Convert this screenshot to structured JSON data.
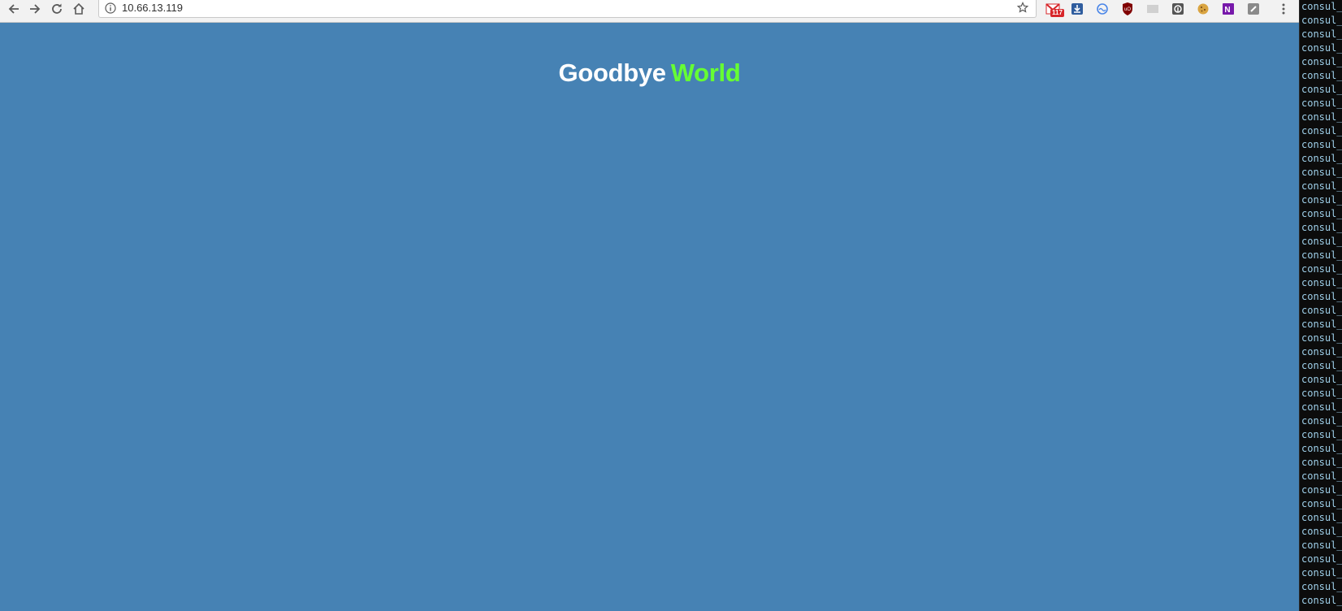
{
  "browser": {
    "url": "10.66.13.119",
    "nav": {
      "back_icon": "arrow-left",
      "forward_icon": "arrow-right",
      "reload_icon": "reload",
      "home_icon": "home"
    },
    "extensions": [
      {
        "name": "gmail-icon",
        "badge": "117"
      },
      {
        "name": "download-icon"
      },
      {
        "name": "sync-icon"
      },
      {
        "name": "ublock-icon"
      },
      {
        "name": "disabled-extension-icon"
      },
      {
        "name": "toggl-icon"
      },
      {
        "name": "cookie-icon"
      },
      {
        "name": "onenote-icon"
      },
      {
        "name": "shield-extension-icon"
      }
    ]
  },
  "page": {
    "background": "#4682b4",
    "heading_word1": "Goodbye",
    "heading_word2": "World",
    "heading_word1_color": "#ffffff",
    "heading_word2_color": "#66ff33"
  },
  "terminal": {
    "line_text": "consul_",
    "line_count": 44
  }
}
